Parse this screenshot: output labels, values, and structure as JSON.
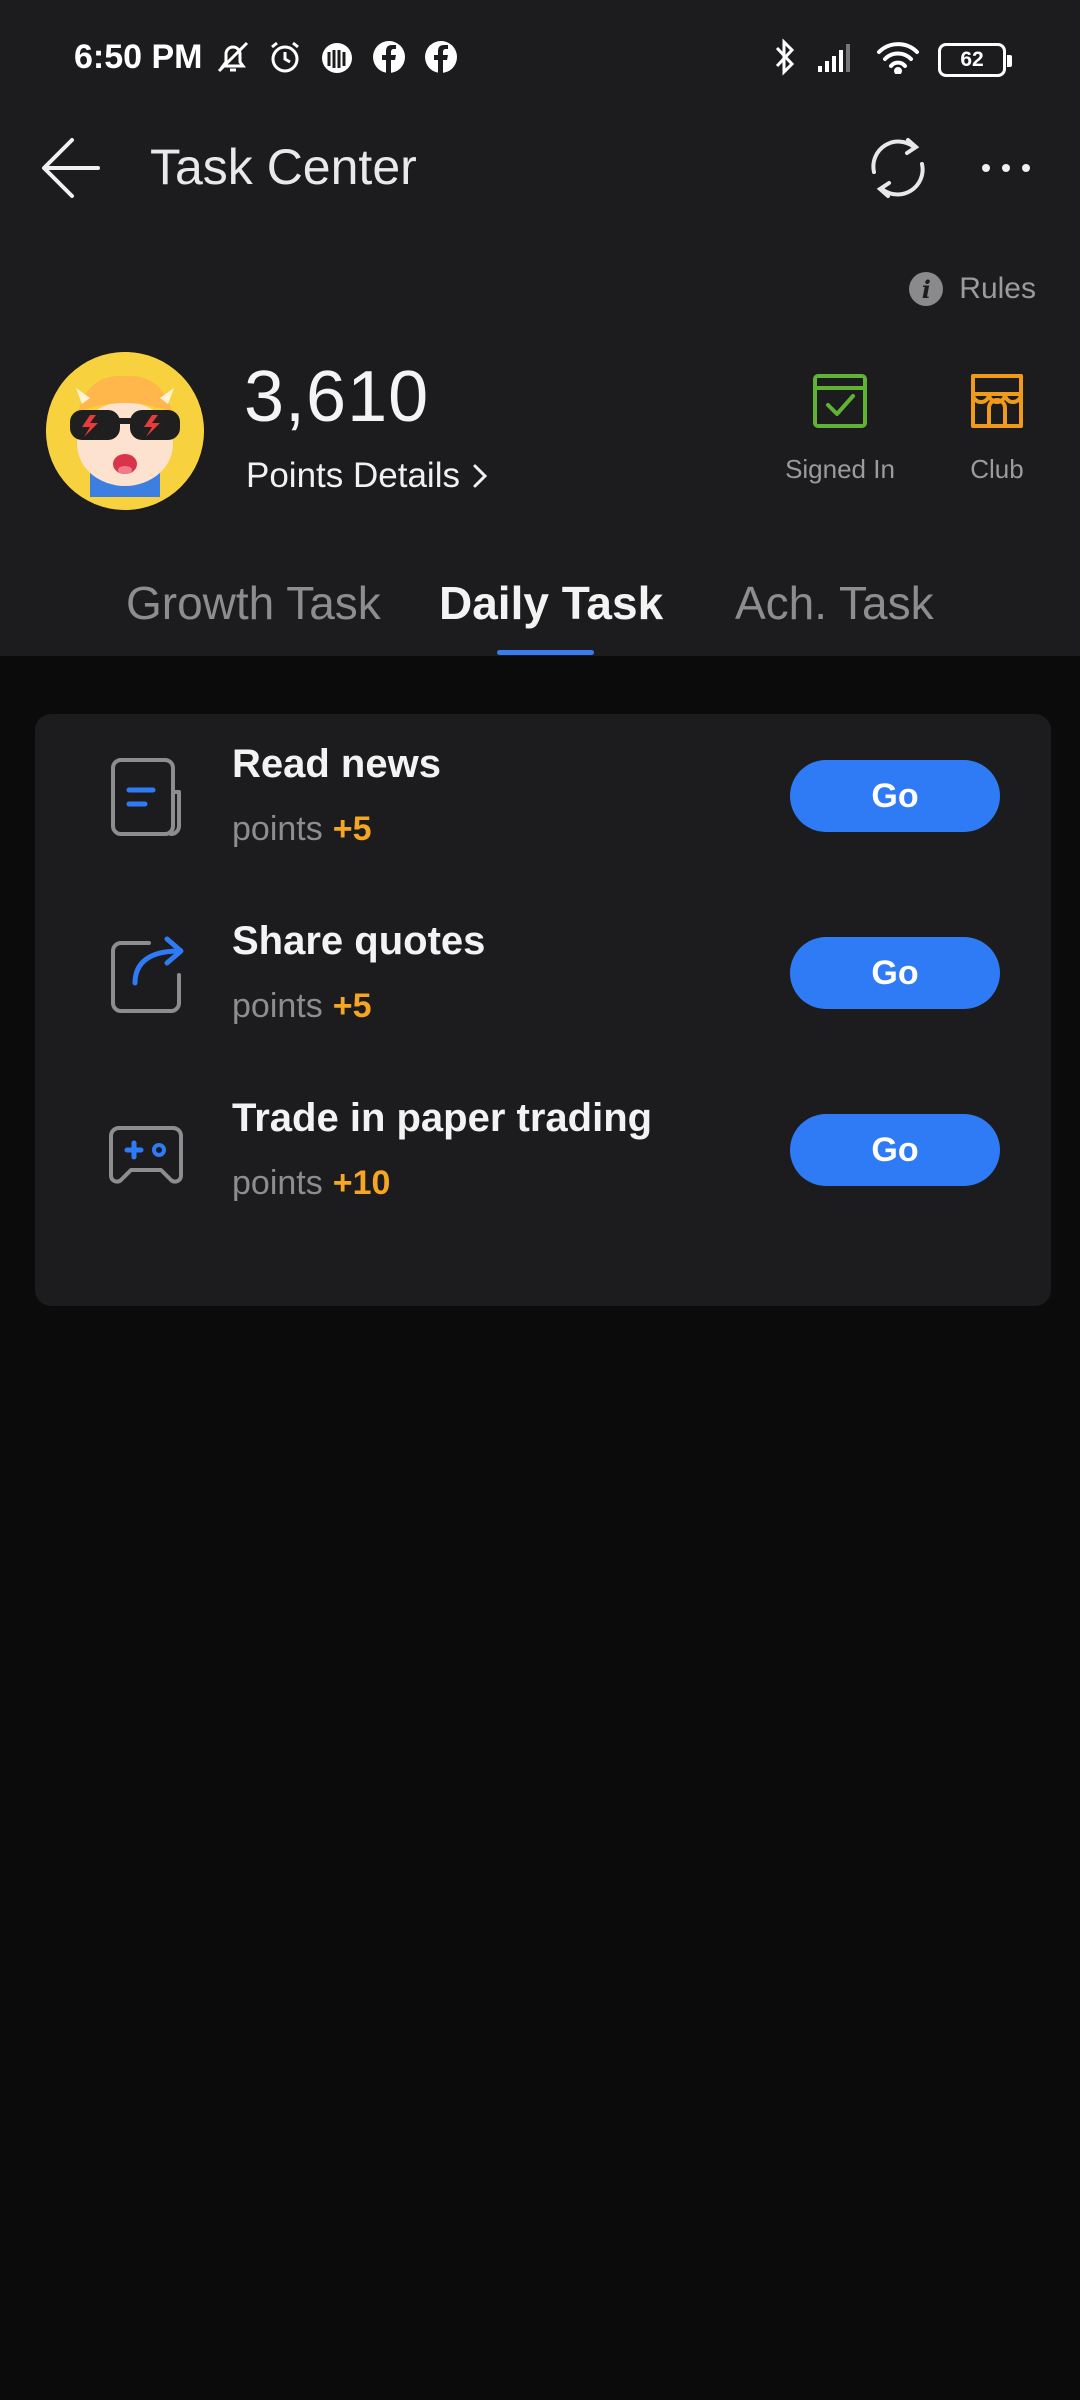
{
  "status_bar": {
    "time": "6:50 PM",
    "battery": "62",
    "left_icons": [
      "notifications-muted-icon",
      "alarm-icon",
      "app-notification-icon",
      "facebook-icon",
      "facebook-icon"
    ],
    "right_icons": [
      "bluetooth-icon",
      "cellular-signal-icon",
      "wifi-icon",
      "battery-icon"
    ]
  },
  "header": {
    "title": "Task Center",
    "back_icon": "arrow-left-icon",
    "refresh_icon": "refresh-icon",
    "more_icon": "more-horizontal-icon"
  },
  "rules": {
    "label": "Rules",
    "icon": "info-icon"
  },
  "profile": {
    "points": "3,610",
    "points_details_label": "Points Details",
    "quick_links": [
      {
        "label": "Signed In",
        "icon": "calendar-check-icon",
        "color": "#5fb233"
      },
      {
        "label": "Club",
        "icon": "store-icon",
        "color": "#f09a1a"
      }
    ]
  },
  "tabs": [
    {
      "label": "Growth Task",
      "active": false
    },
    {
      "label": "Daily Task",
      "active": true
    },
    {
      "label": "Ach. Task",
      "active": false
    }
  ],
  "tasks": [
    {
      "title": "Read news",
      "points_label": "points",
      "bonus": "+5",
      "button": "Go",
      "icon": "news-icon"
    },
    {
      "title": "Share quotes",
      "points_label": "points",
      "bonus": "+5",
      "button": "Go",
      "icon": "share-icon"
    },
    {
      "title": "Trade in paper trading",
      "points_label": "points",
      "bonus": "+10",
      "button": "Go",
      "icon": "gamepad-icon"
    }
  ],
  "colors": {
    "accent": "#2f7bf5",
    "bonus": "#f5a623",
    "header_bg": "#1c1c1e",
    "page_bg": "#0b0b0c"
  }
}
